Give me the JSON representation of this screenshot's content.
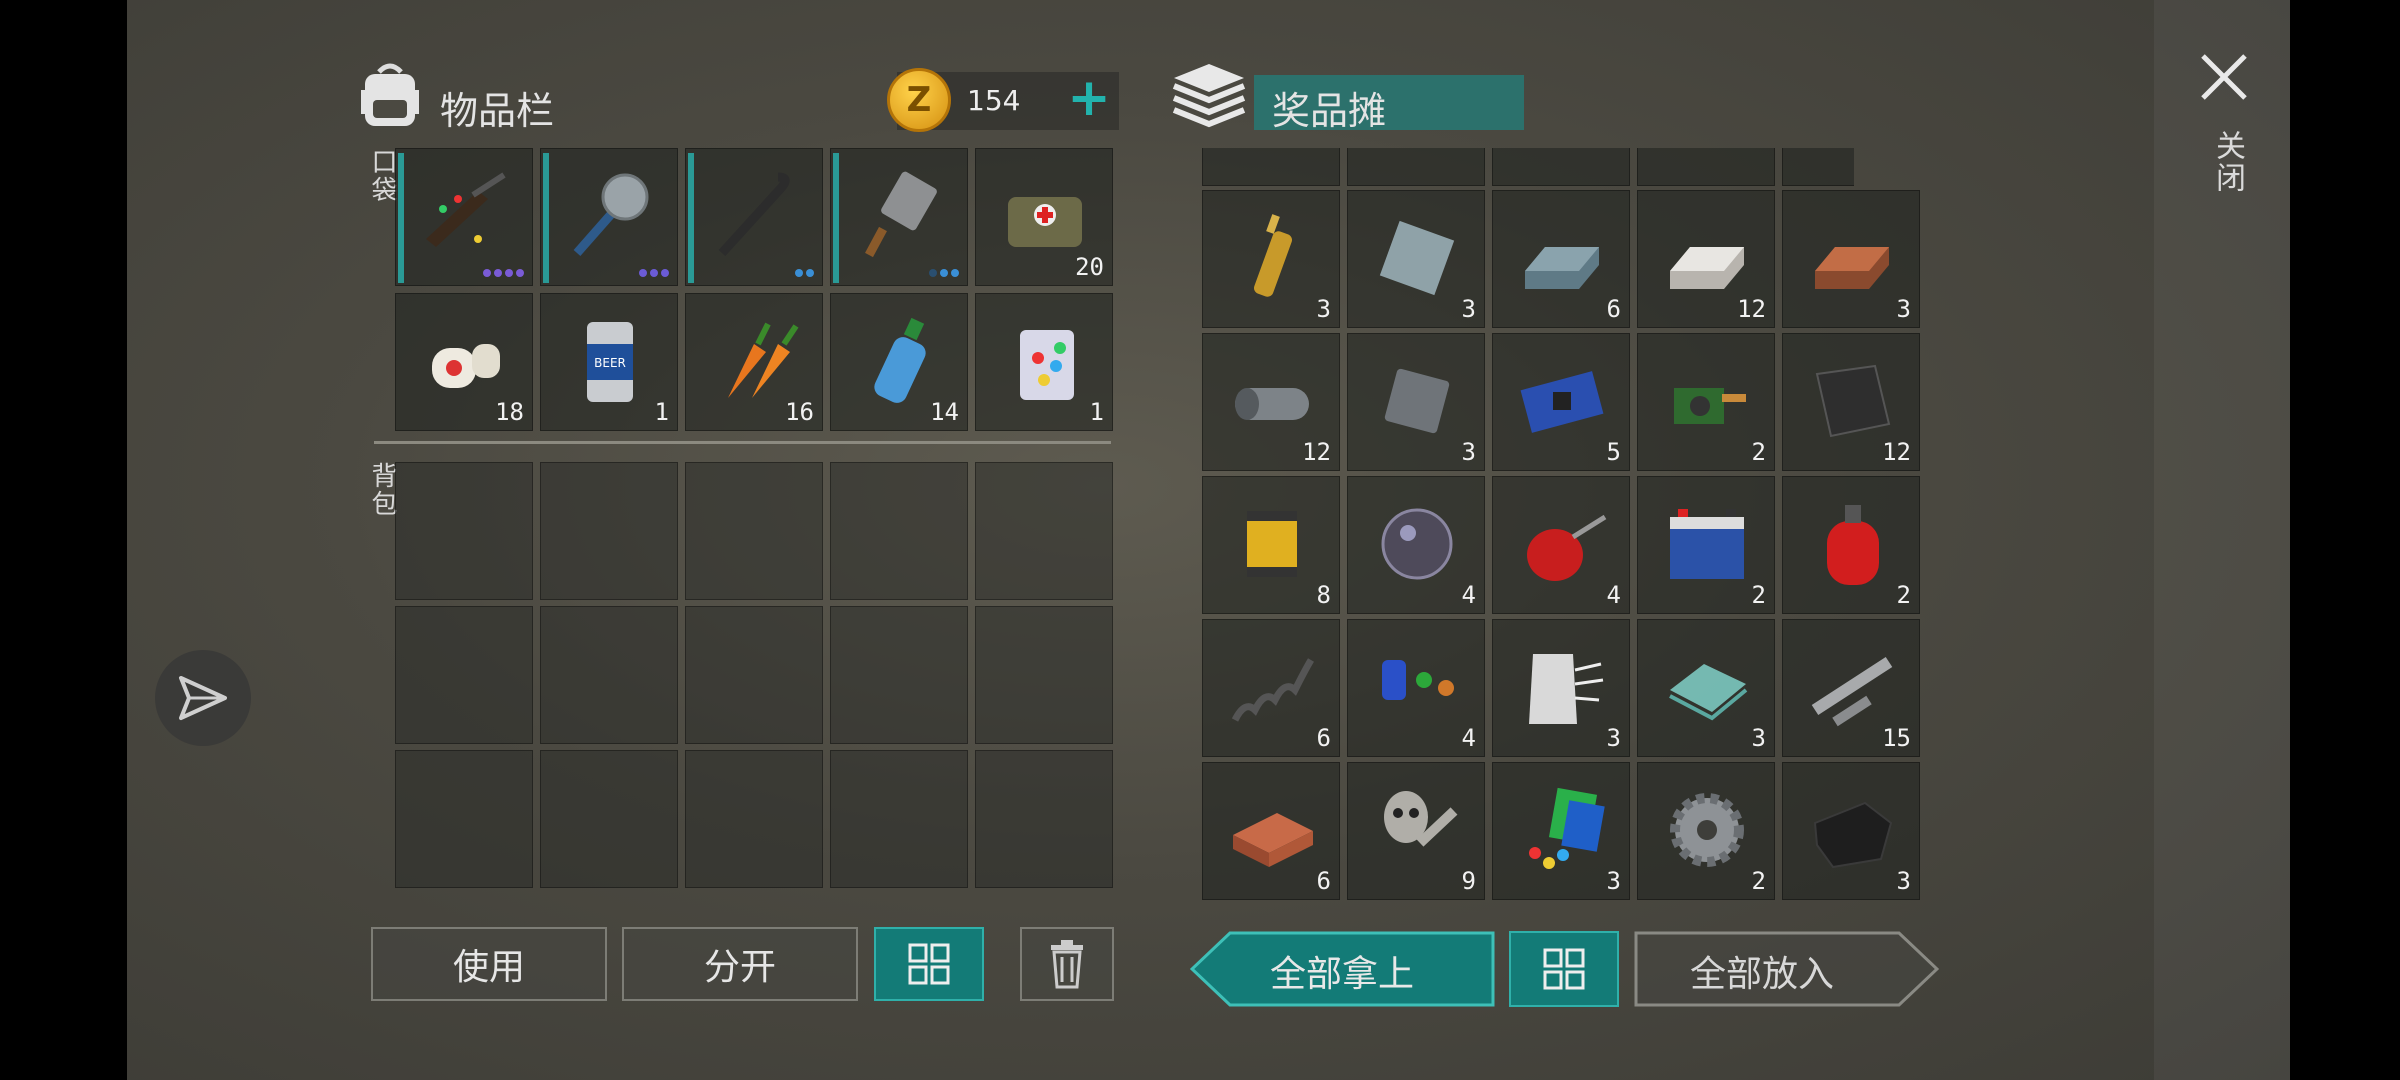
{
  "inventory": {
    "title": "物品栏",
    "coins": "154",
    "pocket_label": "口袋",
    "backpack_label": "背包",
    "pocket_row1": [
      {
        "name": "confetti-rifle",
        "icon": "rifle-icon",
        "count": "",
        "dots": [
          "#7a5bd6",
          "#7a5bd6",
          "#7a5bd6",
          "#7a5bd6"
        ]
      },
      {
        "name": "saw-mace",
        "icon": "saw-mace-icon",
        "count": "",
        "dots": [
          "#6b5bd6",
          "#6b5bd6",
          "#6b5bd6"
        ]
      },
      {
        "name": "crowbar",
        "icon": "crowbar-icon",
        "count": "",
        "dots": [
          "#3a8fd6",
          "#3a8fd6"
        ]
      },
      {
        "name": "cleaver",
        "icon": "cleaver-icon",
        "count": "",
        "dots": [
          "#2a4f70",
          "#3a8fd6",
          "#3a8fd6"
        ]
      },
      {
        "name": "medkit-bag",
        "icon": "medkit-icon",
        "count": "20",
        "dots": []
      }
    ],
    "pocket_row2": [
      {
        "name": "bandage",
        "icon": "bandage-icon",
        "count": "18"
      },
      {
        "name": "beer-can",
        "icon": "beer-can-icon",
        "count": "1"
      },
      {
        "name": "carrots",
        "icon": "carrot-icon",
        "count": "16"
      },
      {
        "name": "water-bottle",
        "icon": "bottle-icon",
        "count": "14"
      },
      {
        "name": "confetti-pack",
        "icon": "confetti-icon",
        "count": "1"
      }
    ]
  },
  "loot": {
    "title": "奖品摊",
    "rows": [
      [
        {
          "icon": "ampoule-icon",
          "count": "3"
        },
        {
          "icon": "steel-plate-icon",
          "count": "3"
        },
        {
          "icon": "steel-ingot-icon",
          "count": "6"
        },
        {
          "icon": "silver-ingot-icon",
          "count": "12"
        },
        {
          "icon": "copper-ingot-icon",
          "count": "3"
        }
      ],
      [
        {
          "icon": "metal-roll-icon",
          "count": "12"
        },
        {
          "icon": "iron-plate-icon",
          "count": "3"
        },
        {
          "icon": "circuit-board-icon",
          "count": "5"
        },
        {
          "icon": "camera-module-icon",
          "count": "2"
        },
        {
          "icon": "carbon-fiber-icon",
          "count": "12"
        }
      ],
      [
        {
          "icon": "air-filter-icon",
          "count": "8"
        },
        {
          "icon": "lens-icon",
          "count": "4"
        },
        {
          "icon": "oil-can-icon",
          "count": "4"
        },
        {
          "icon": "battery-icon",
          "count": "2"
        },
        {
          "icon": "gas-cylinder-icon",
          "count": "2"
        }
      ],
      [
        {
          "icon": "spring-icon",
          "count": "6"
        },
        {
          "icon": "capacitors-icon",
          "count": "4"
        },
        {
          "icon": "fiberglass-icon",
          "count": "3"
        },
        {
          "icon": "glass-icon",
          "count": "3"
        },
        {
          "icon": "pipes-icon",
          "count": "15"
        }
      ],
      [
        {
          "icon": "brick-icon",
          "count": "6"
        },
        {
          "icon": "mask-parts-icon",
          "count": "9"
        },
        {
          "icon": "plastic-icon",
          "count": "3"
        },
        {
          "icon": "gear-icon",
          "count": "2"
        },
        {
          "icon": "leather-icon",
          "count": "3"
        }
      ]
    ]
  },
  "buttons": {
    "use": "使用",
    "split": "分开",
    "take_all": "全部拿上",
    "put_all": "全部放入"
  },
  "close_label": "关闭",
  "colors": {
    "teal": "#137b77",
    "coin": "#e0a21a"
  }
}
